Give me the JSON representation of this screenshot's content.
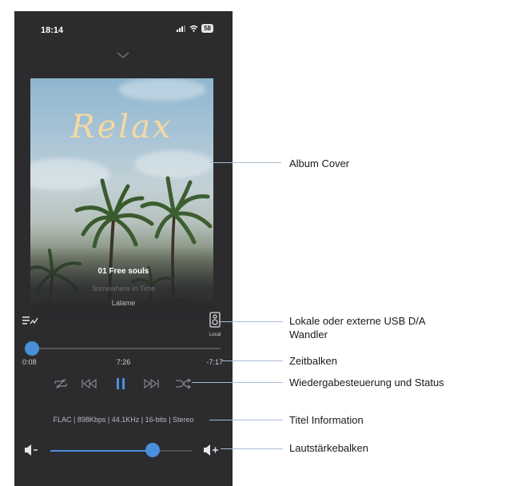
{
  "status_bar": {
    "time": "18:14",
    "battery": "58"
  },
  "cover": {
    "overlay_text": "Relax"
  },
  "track": {
    "title": "01 Free souls",
    "album": "Somewhere in Time",
    "artist": "Lalame"
  },
  "output": {
    "label": "Local"
  },
  "playback": {
    "elapsed": "0:08",
    "duration": "7:26",
    "remaining": "-7:17",
    "progress_fraction": 0.018
  },
  "file_info": "FLAC | 898Kbps | 44.1KHz | 16-bits | Stereo",
  "volume": {
    "level_fraction": 0.72
  },
  "annotations": {
    "album_cover": "Album Cover",
    "dac_line1": "Lokale oder externe USB D/A",
    "dac_line2": "Wandler",
    "time_bar": "Zeitbalken",
    "controls": "Wiedergabesteuerung und Status",
    "title_info": "Titel Information",
    "volume_bar": "Lautstärkebalken"
  },
  "colors": {
    "accent": "#4a8fdc",
    "background": "#2c2c2f",
    "cover_title": "#f5d9a0"
  },
  "icons": [
    "chevron-down-icon",
    "signal-icon",
    "wifi-icon",
    "queue-icon",
    "speaker-icon",
    "repeat-off-icon",
    "previous-icon",
    "pause-icon",
    "next-icon",
    "shuffle-icon",
    "volume-down-icon",
    "volume-up-icon"
  ]
}
